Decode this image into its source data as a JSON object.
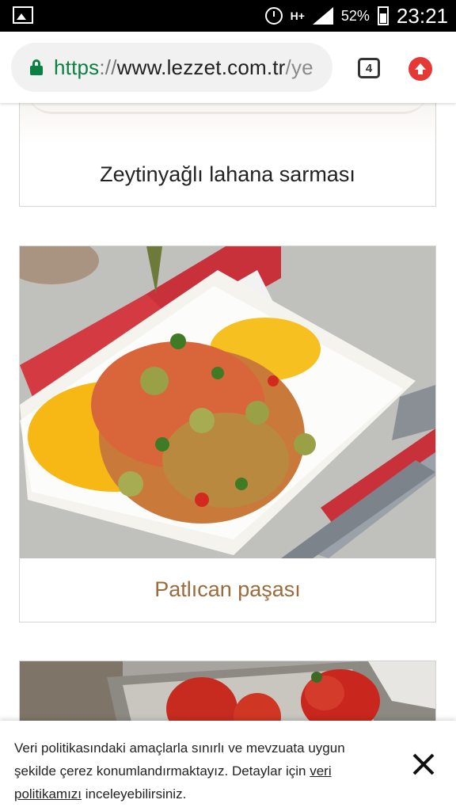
{
  "status_bar": {
    "network": "H+",
    "battery": "52%",
    "time": "23:21"
  },
  "browser": {
    "url_scheme": "https",
    "url_separator": "://",
    "url_host": "www.lezzet.com.tr",
    "url_path": "/ye",
    "tab_count": "4",
    "icons": [
      "gallery-icon",
      "alarm-icon",
      "signal-icon",
      "battery-icon",
      "lock-icon",
      "tab-switcher-icon",
      "update-icon"
    ]
  },
  "recipes": [
    {
      "title": "Zeytinyağlı lahana sarması"
    },
    {
      "title": "Patlıcan paşası"
    }
  ],
  "cookie_banner": {
    "text_before_link": "Veri politikasındaki amaçlarla sınırlı ve mevzuata uygun şekilde çerez konumlandırmaktayız. Detaylar için ",
    "link_text": "veri politikamızı",
    "text_after_link": " inceleyebilirsiniz.",
    "close_icon": "close-icon"
  },
  "colors": {
    "secure_green": "#0b8043",
    "title_brown": "#9a6b3b",
    "update_red": "#e53935"
  }
}
